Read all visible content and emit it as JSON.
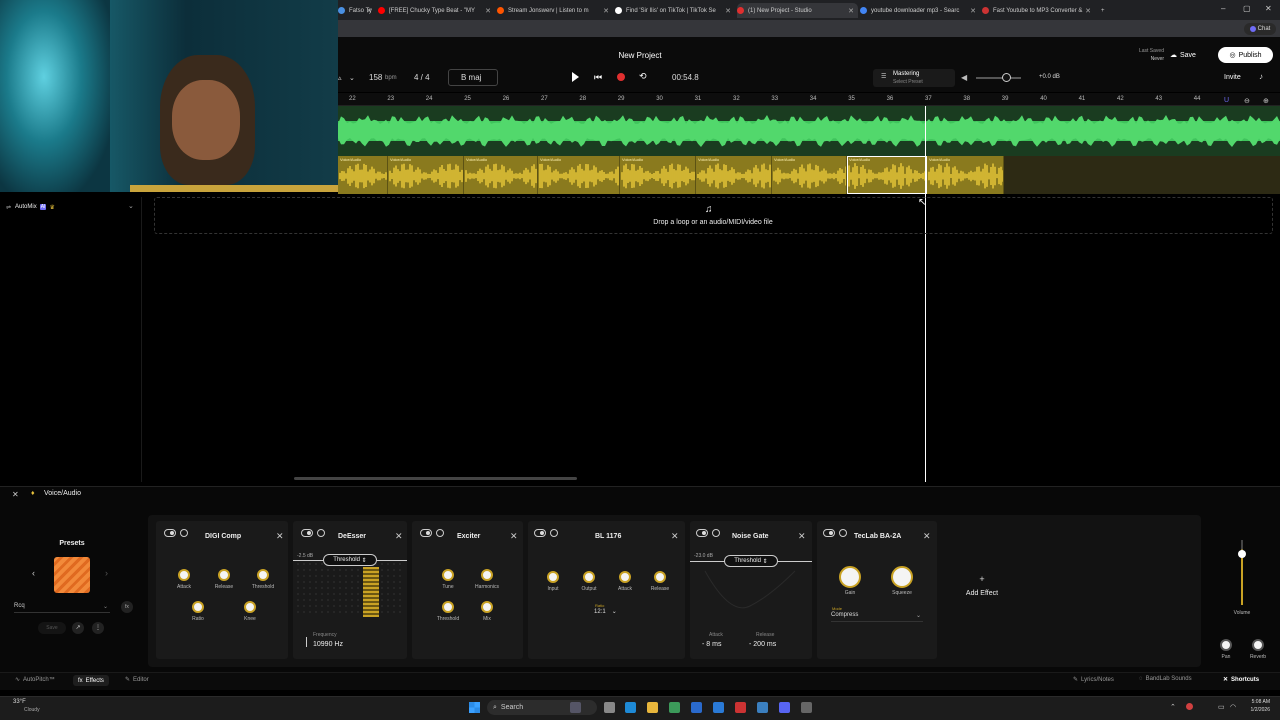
{
  "browser": {
    "tabs": [
      {
        "title": "Fatso Ty",
        "color": "#4a90e2"
      },
      {
        "title": "[FREE] Chucky Type Beat - \"MY",
        "color": "#ff0000"
      },
      {
        "title": "Stream Jonswerv | Listen to m",
        "color": "#ff5500"
      },
      {
        "title": "Find 'Sir Ilis' on TikTok | TikTok Se",
        "color": "#ffffff"
      },
      {
        "title": "(1) New Project - Studio",
        "color": "#e02f2f"
      },
      {
        "title": "youtube downloader mp3 - Searc",
        "color": "#4285f4"
      },
      {
        "title": "Fast Youtube to MP3 Converter &",
        "color": "#cc3333"
      }
    ],
    "chat_label": "Chat"
  },
  "project": {
    "title": "New Project",
    "last_saved_label": "Last Saved",
    "last_saved_value": "Never",
    "save": "Save",
    "publish": "Publish",
    "invite": "Invite"
  },
  "transport": {
    "tempo": "158",
    "tempo_unit": "bpm",
    "time_sig": "4 / 4",
    "key": "B maj",
    "time": "00:54.8"
  },
  "mastering": {
    "label": "Mastering",
    "preset": "Select Preset",
    "volume": "+0.0 dB"
  },
  "ruler": [
    "22",
    "23",
    "24",
    "25",
    "26",
    "27",
    "28",
    "29",
    "30",
    "31",
    "32",
    "33",
    "34",
    "35",
    "36",
    "37",
    "38",
    "39",
    "40",
    "41",
    "42",
    "43",
    "44"
  ],
  "tracks": {
    "clip_label": "Voice/Audio",
    "drop_text": "Drop a loop or an audio/MIDI/video file",
    "track_name": "AutoMix",
    "ai_badge": "AI"
  },
  "fx_panel": {
    "track": "Voice/Audio",
    "presets_label": "Presets",
    "preset_name": "Rcq",
    "save_label": "Save",
    "add_effect": "Add Effect",
    "volume_label": "Volume",
    "pan_label": "Pan",
    "reverb_label": "Reverb",
    "effects": {
      "digicomp": {
        "name": "DIGI Comp",
        "k1": "Attack",
        "k2": "Release",
        "k3": "Threshold",
        "k4": "Ratio",
        "k5": "Knee"
      },
      "deesser": {
        "name": "DeEsser",
        "thr_value": "-2.5 dB",
        "thr_label": "Threshold",
        "freq_label": "Frequency",
        "freq_value": "10990 Hz"
      },
      "exciter": {
        "name": "Exciter",
        "k1": "Tune",
        "k2": "Harmonics",
        "k3": "Threshold",
        "k4": "Mix"
      },
      "bl1176": {
        "name": "BL 1176",
        "k1": "Input",
        "k2": "Output",
        "k3": "Attack",
        "k4": "Release",
        "ratio_label": "Ratio",
        "ratio_value": "12:1"
      },
      "noisegate": {
        "name": "Noise Gate",
        "thr_value": "-23.0 dB",
        "thr_label": "Threshold",
        "attack_label": "Attack",
        "attack_value": "8 ms",
        "release_label": "Release",
        "release_value": "200 ms"
      },
      "teclab": {
        "name": "TecLab BA-2A",
        "k1": "Gain",
        "k2": "Squeeze",
        "mode_label": "Mode",
        "mode_value": "Compress"
      }
    }
  },
  "bottom": {
    "autopitch": "AutoPitch™",
    "effects": "Effects",
    "editor": "Editor",
    "lyrics": "Lyrics/Notes",
    "sounds": "BandLab Sounds",
    "shortcuts": "Shortcuts"
  },
  "taskbar": {
    "temp": "33°F",
    "weather": "Cloudy",
    "search": "Search",
    "time": "5:08 AM",
    "date": "1/2/2026"
  }
}
